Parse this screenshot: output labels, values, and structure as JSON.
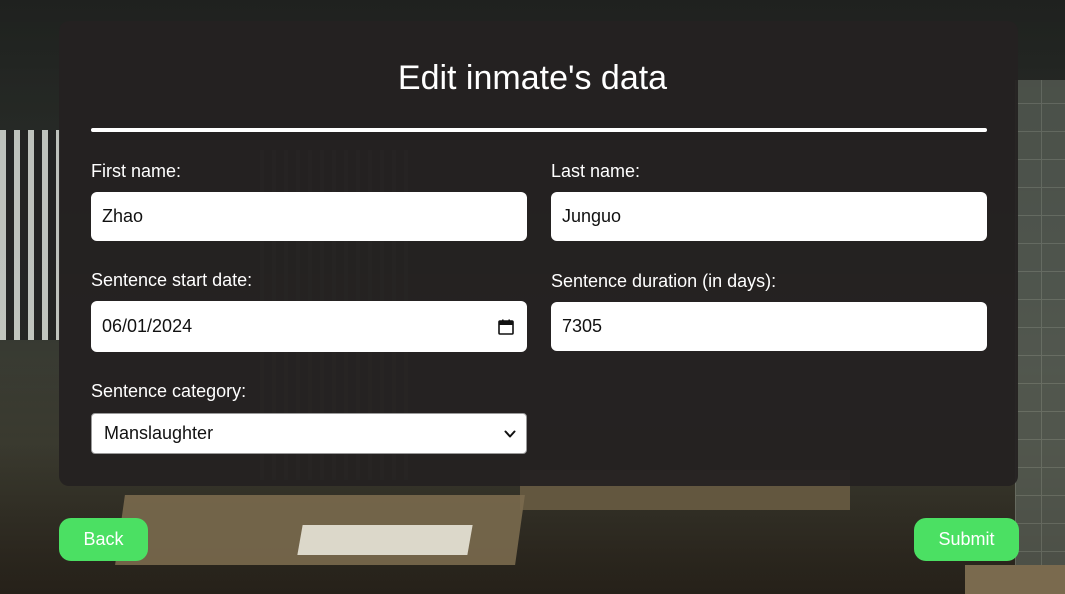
{
  "form": {
    "title": "Edit inmate's data",
    "first_name": {
      "label": "First name:",
      "value": "Zhao"
    },
    "last_name": {
      "label": "Last name:",
      "value": "Junguo"
    },
    "start_date": {
      "label": "Sentence start date:",
      "value": "06/01/2024",
      "icon": "calendar-icon"
    },
    "duration": {
      "label": "Sentence duration (in days):",
      "value": "7305"
    },
    "category": {
      "label": "Sentence category:",
      "selected": "Manslaughter",
      "icon": "chevron-down-icon"
    }
  },
  "actions": {
    "back_label": "Back",
    "submit_label": "Submit"
  },
  "colors": {
    "accent": "#4be063",
    "card": "#242121",
    "text": "#ffffff"
  }
}
